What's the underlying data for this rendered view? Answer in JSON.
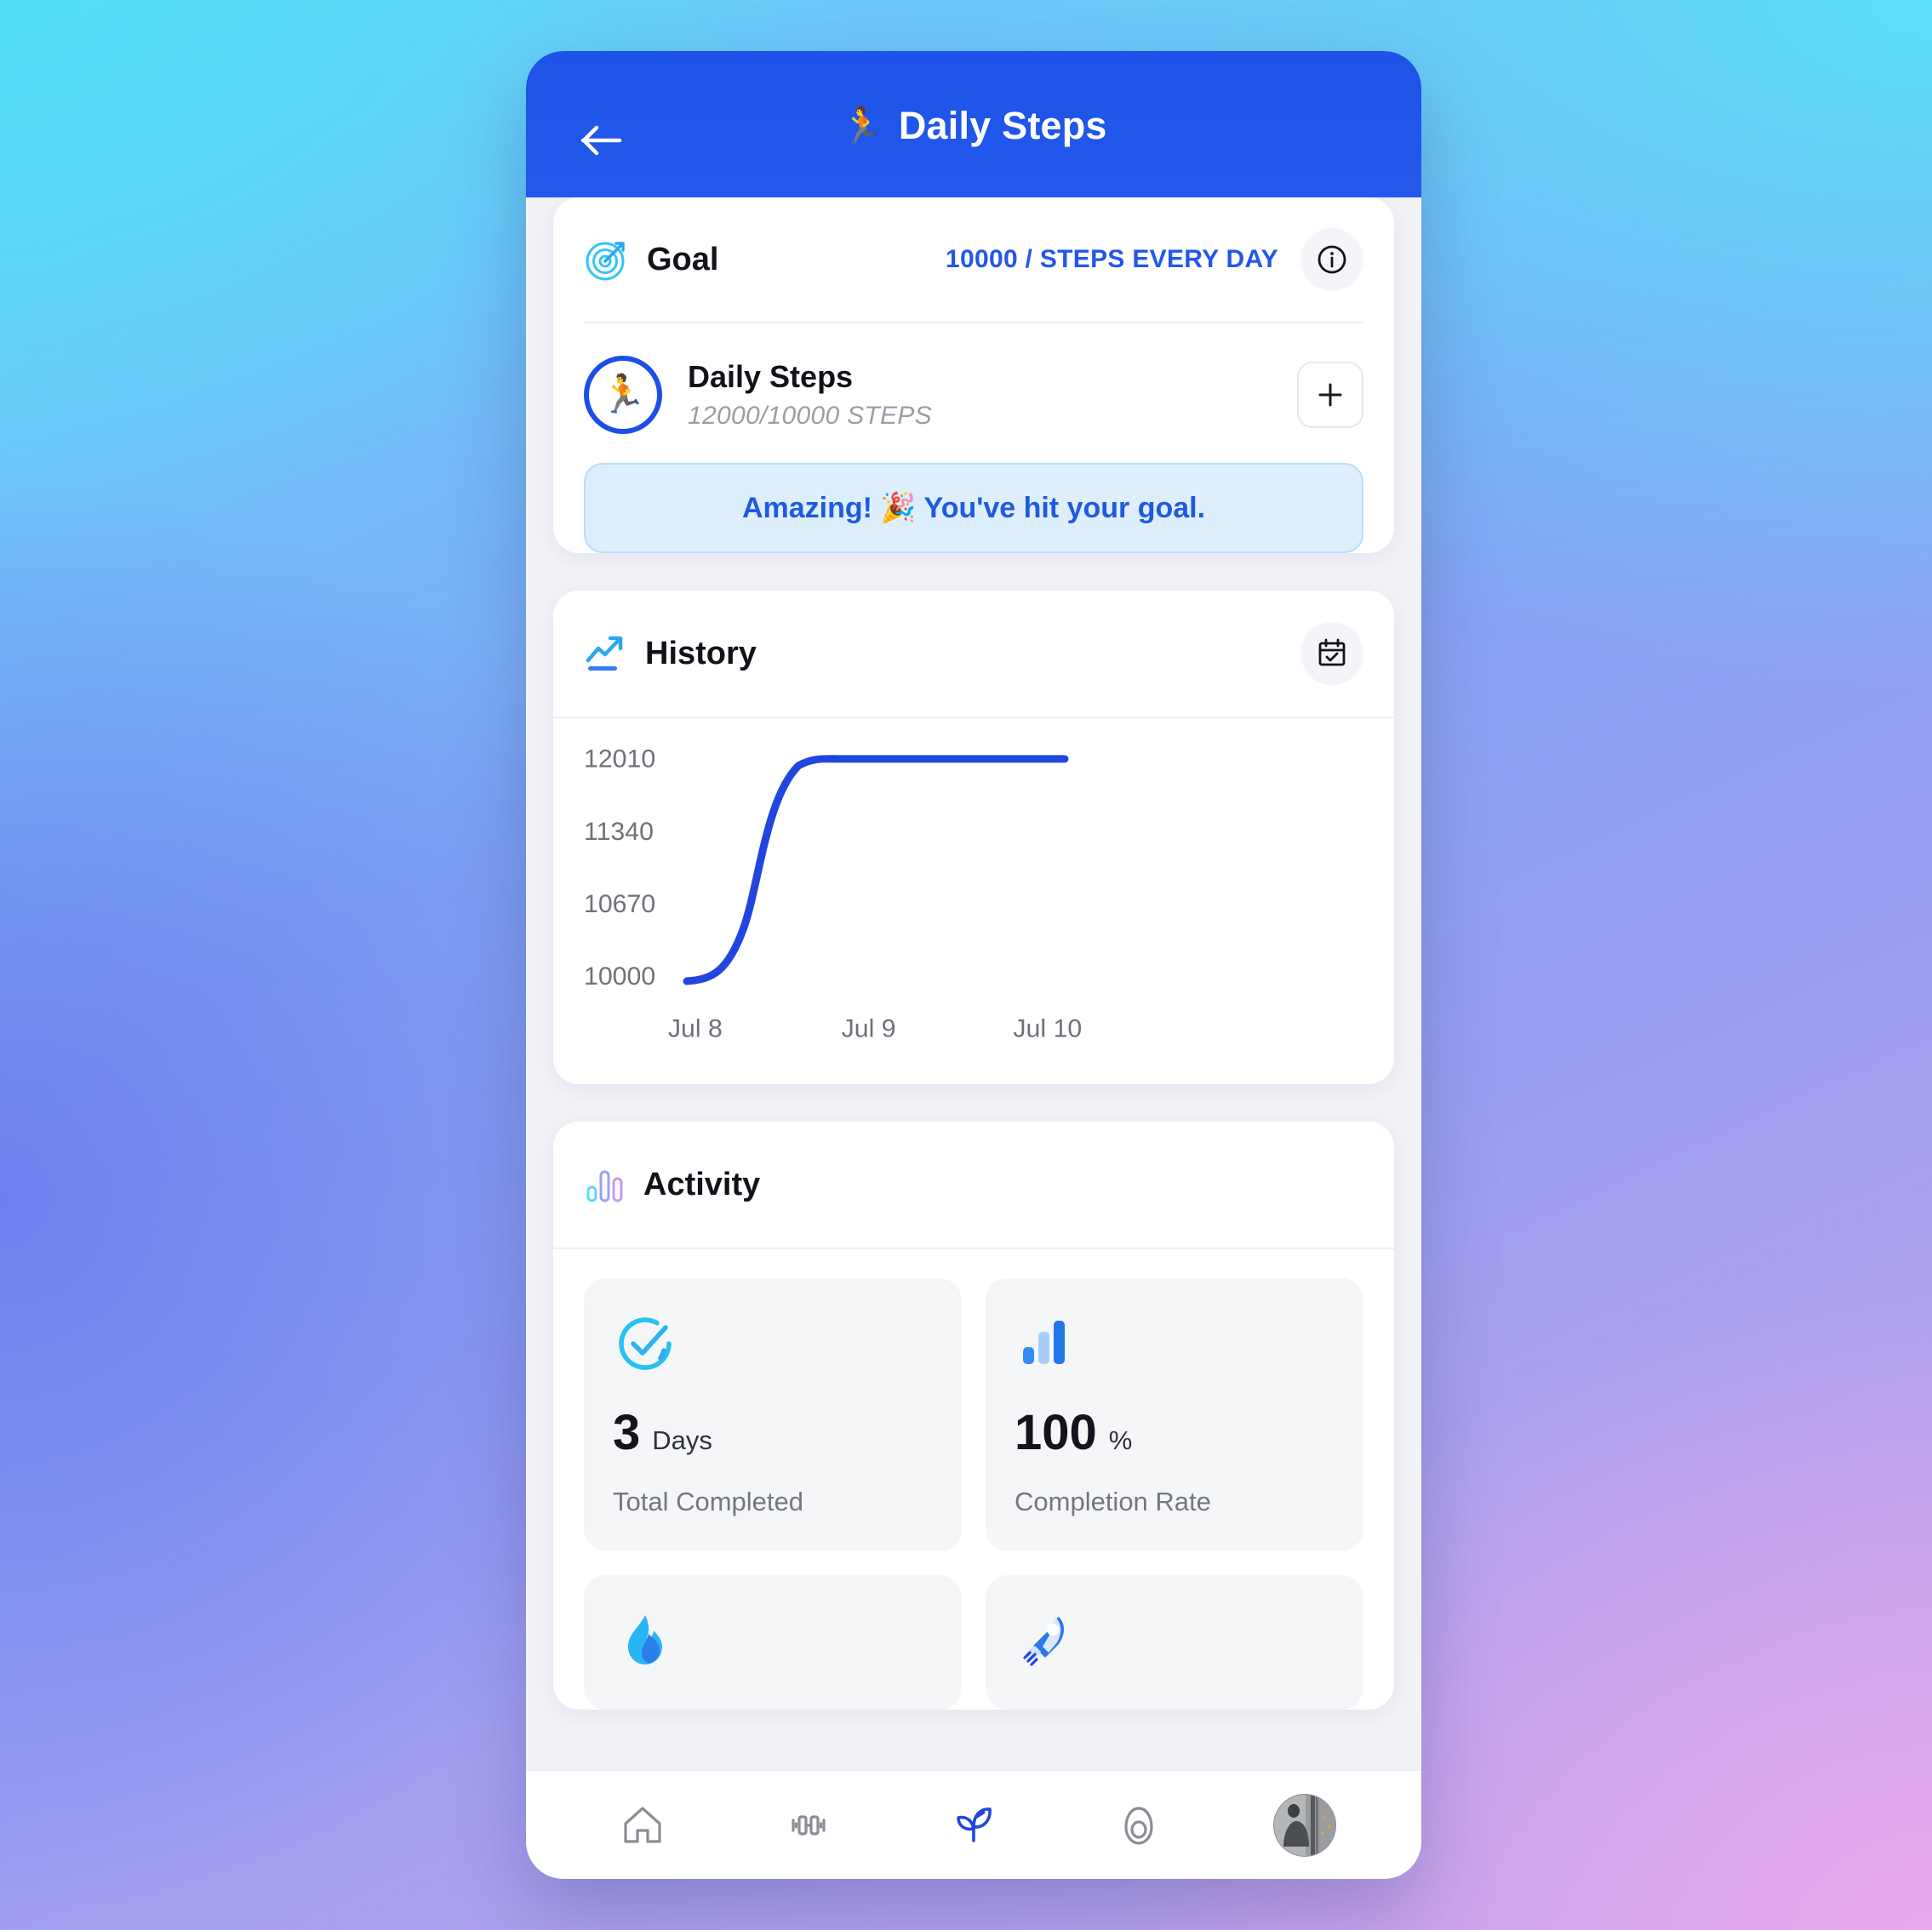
{
  "app": {
    "header": {
      "title": "Daily Steps",
      "title_emoji": "🏃",
      "back_icon": "arrow-left-icon",
      "bg_color": "#2257ea"
    }
  },
  "goal_card": {
    "icon": "target-icon",
    "title": "Goal",
    "target_text": "10000 / STEPS EVERY DAY",
    "info_icon": "info-icon",
    "item": {
      "avatar_emoji": "🏃",
      "name": "Daily Steps",
      "progress_text": "12000/10000 STEPS",
      "add_icon": "plus-icon"
    },
    "banner_text": "Amazing! 🎉 You've hit your goal.",
    "accent_color": "#2257ea"
  },
  "history_card": {
    "icon": "chart-increasing-icon",
    "title": "History",
    "calendar_icon": "calendar-check-icon"
  },
  "chart_data": {
    "type": "line",
    "title": "History",
    "x": [
      "Jul 8",
      "Jul 9",
      "Jul 10"
    ],
    "values": [
      10000,
      12010,
      12010
    ],
    "xlabel": "",
    "ylabel": "",
    "ytick_labels": [
      "12010",
      "11340",
      "10670",
      "10000"
    ],
    "ytick_values": [
      12010,
      11340,
      10670,
      10000
    ],
    "ylim": [
      10000,
      12010
    ],
    "grid": false,
    "legend": false,
    "line_color": "#2146e0",
    "line_width": 8,
    "smooth": true
  },
  "activity_card": {
    "icon": "bar-chart-icon",
    "title": "Activity",
    "stats": [
      {
        "icon": "circle-check-icon",
        "value": "3",
        "unit": "Days",
        "label": "Total Completed"
      },
      {
        "icon": "bar-chart-blue-icon",
        "value": "100",
        "unit": "%",
        "label": "Completion Rate"
      },
      {
        "icon": "flame-icon",
        "value": "",
        "unit": "",
        "label": ""
      },
      {
        "icon": "rocket-icon",
        "value": "",
        "unit": "",
        "label": ""
      }
    ]
  },
  "bottom_nav": {
    "items": [
      {
        "icon": "home-icon",
        "active": false
      },
      {
        "icon": "dumbbell-icon",
        "active": false
      },
      {
        "icon": "sprout-icon",
        "active": true
      },
      {
        "icon": "avocado-icon",
        "active": false
      },
      {
        "icon": "profile-avatar",
        "active": false
      }
    ],
    "active_color": "#2146e0",
    "inactive_color": "#8a8d95"
  }
}
